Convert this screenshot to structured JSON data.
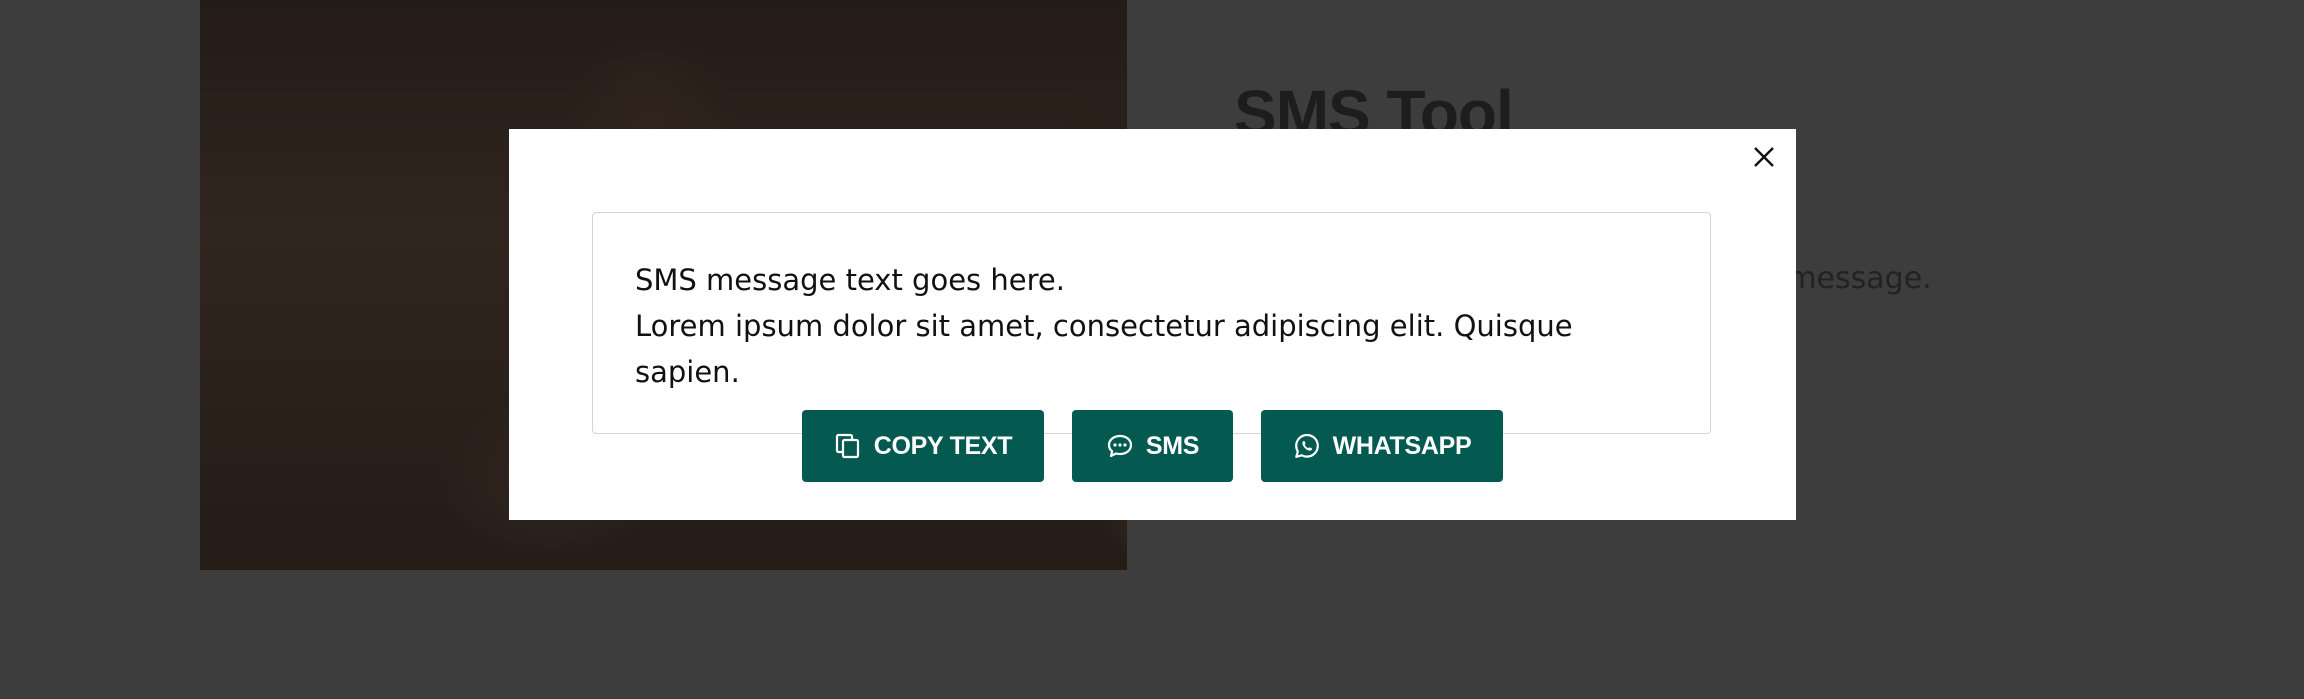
{
  "background": {
    "title": "SMS Tool",
    "description": "Click one of the buttons to send this message."
  },
  "modal": {
    "close_icon": "close-icon",
    "message": "SMS message text goes here.\nLorem ipsum dolor sit amet, consectetur adipiscing elit. Quisque sapien.",
    "buttons": {
      "copy": {
        "label": "COPY TEXT",
        "icon": "copy-icon"
      },
      "sms": {
        "label": "SMS",
        "icon": "chat-bubble-icon"
      },
      "whatsapp": {
        "label": "WHATSAPP",
        "icon": "whatsapp-icon"
      }
    }
  },
  "colors": {
    "overlay": "#3d3d3d",
    "button": "#045a50",
    "button_text": "#ffffff"
  }
}
